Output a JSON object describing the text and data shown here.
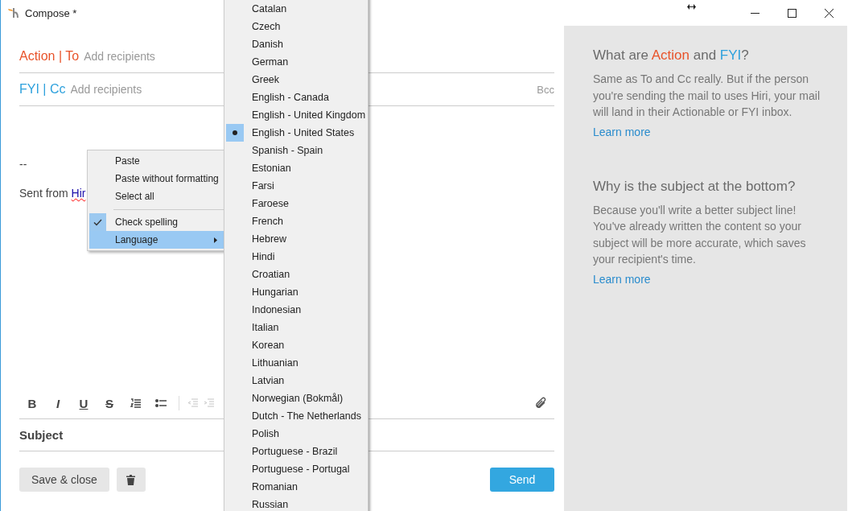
{
  "window": {
    "title": "Compose *"
  },
  "recipients": [
    {
      "kind": "action",
      "label": "Action | To",
      "placeholder": "Add recipients",
      "color": "#e8532a"
    },
    {
      "kind": "fyi",
      "label": "FYI | Cc",
      "placeholder": "Add recipients",
      "color": "#2ea1dd",
      "extra": "Bcc"
    }
  ],
  "body": {
    "separator": "--",
    "signature": "Sent from ",
    "link": "Hir"
  },
  "toolbar": [
    {
      "kind": "bold",
      "label": "B",
      "disabled": false
    },
    {
      "kind": "italic",
      "label": "I",
      "disabled": false
    },
    {
      "kind": "underline",
      "label": "U",
      "disabled": false
    },
    {
      "kind": "strike",
      "label": "S",
      "disabled": false
    },
    {
      "kind": "numbered-list",
      "disabled": false
    },
    {
      "kind": "bullet-list",
      "disabled": false
    },
    {
      "kind": "divider"
    },
    {
      "kind": "outdent",
      "disabled": true
    },
    {
      "kind": "indent",
      "disabled": true
    }
  ],
  "subject": {
    "placeholder": "Subject"
  },
  "buttons": {
    "save": "Save & close",
    "send": "Send"
  },
  "context_menu": [
    {
      "kind": "item",
      "label": "Paste",
      "checked": false,
      "selected": false
    },
    {
      "kind": "item",
      "label": "Paste without formatting",
      "checked": false,
      "selected": false
    },
    {
      "kind": "item",
      "label": "Select all",
      "checked": false,
      "selected": false
    },
    {
      "kind": "separator"
    },
    {
      "kind": "item",
      "label": "Check spelling",
      "checked": true,
      "selected": false
    },
    {
      "kind": "submenu",
      "label": "Language",
      "checked": false,
      "selected": true
    }
  ],
  "language_menu": [
    {
      "label": "Catalan",
      "selected": false
    },
    {
      "label": "Czech",
      "selected": false
    },
    {
      "label": "Danish",
      "selected": false
    },
    {
      "label": "German",
      "selected": false
    },
    {
      "label": "Greek",
      "selected": false
    },
    {
      "label": "English - Canada",
      "selected": false
    },
    {
      "label": "English - United Kingdom",
      "selected": false
    },
    {
      "label": "English - United States",
      "selected": true
    },
    {
      "label": "Spanish - Spain",
      "selected": false
    },
    {
      "label": "Estonian",
      "selected": false
    },
    {
      "label": "Farsi",
      "selected": false
    },
    {
      "label": "Faroese",
      "selected": false
    },
    {
      "label": "French",
      "selected": false
    },
    {
      "label": "Hebrew",
      "selected": false
    },
    {
      "label": "Hindi",
      "selected": false
    },
    {
      "label": "Croatian",
      "selected": false
    },
    {
      "label": "Hungarian",
      "selected": false
    },
    {
      "label": "Indonesian",
      "selected": false
    },
    {
      "label": "Italian",
      "selected": false
    },
    {
      "label": "Korean",
      "selected": false
    },
    {
      "label": "Lithuanian",
      "selected": false
    },
    {
      "label": "Latvian",
      "selected": false
    },
    {
      "label": "Norwegian (Bokmål)",
      "selected": false
    },
    {
      "label": "Dutch - The Netherlands",
      "selected": false
    },
    {
      "label": "Polish",
      "selected": false
    },
    {
      "label": "Portuguese - Brazil",
      "selected": false
    },
    {
      "label": "Portuguese - Portugal",
      "selected": false
    },
    {
      "label": "Romanian",
      "selected": false
    },
    {
      "label": "Russian",
      "selected": false
    }
  ],
  "help": [
    {
      "title": [
        {
          "text": "What are ",
          "color": "#6b6b6b"
        },
        {
          "text": "Action",
          "color": "#e8532a"
        },
        {
          "text": " and ",
          "color": "#6b6b6b"
        },
        {
          "text": "FYI",
          "color": "#2ea1dd"
        },
        {
          "text": "?",
          "color": "#6b6b6b"
        }
      ],
      "text": "Same as To and Cc really. But if the person you're sending the mail to uses Hiri, your mail will land in their Actionable or FYI inbox.",
      "link": "Learn more"
    },
    {
      "title": [
        {
          "text": "Why is the subject at the bottom?",
          "color": "#6b6b6b"
        }
      ],
      "text": "Because you'll write a better subject line! You've already written the content so your subject will be more accurate, which saves your recipient's time.",
      "link": "Learn more"
    }
  ]
}
